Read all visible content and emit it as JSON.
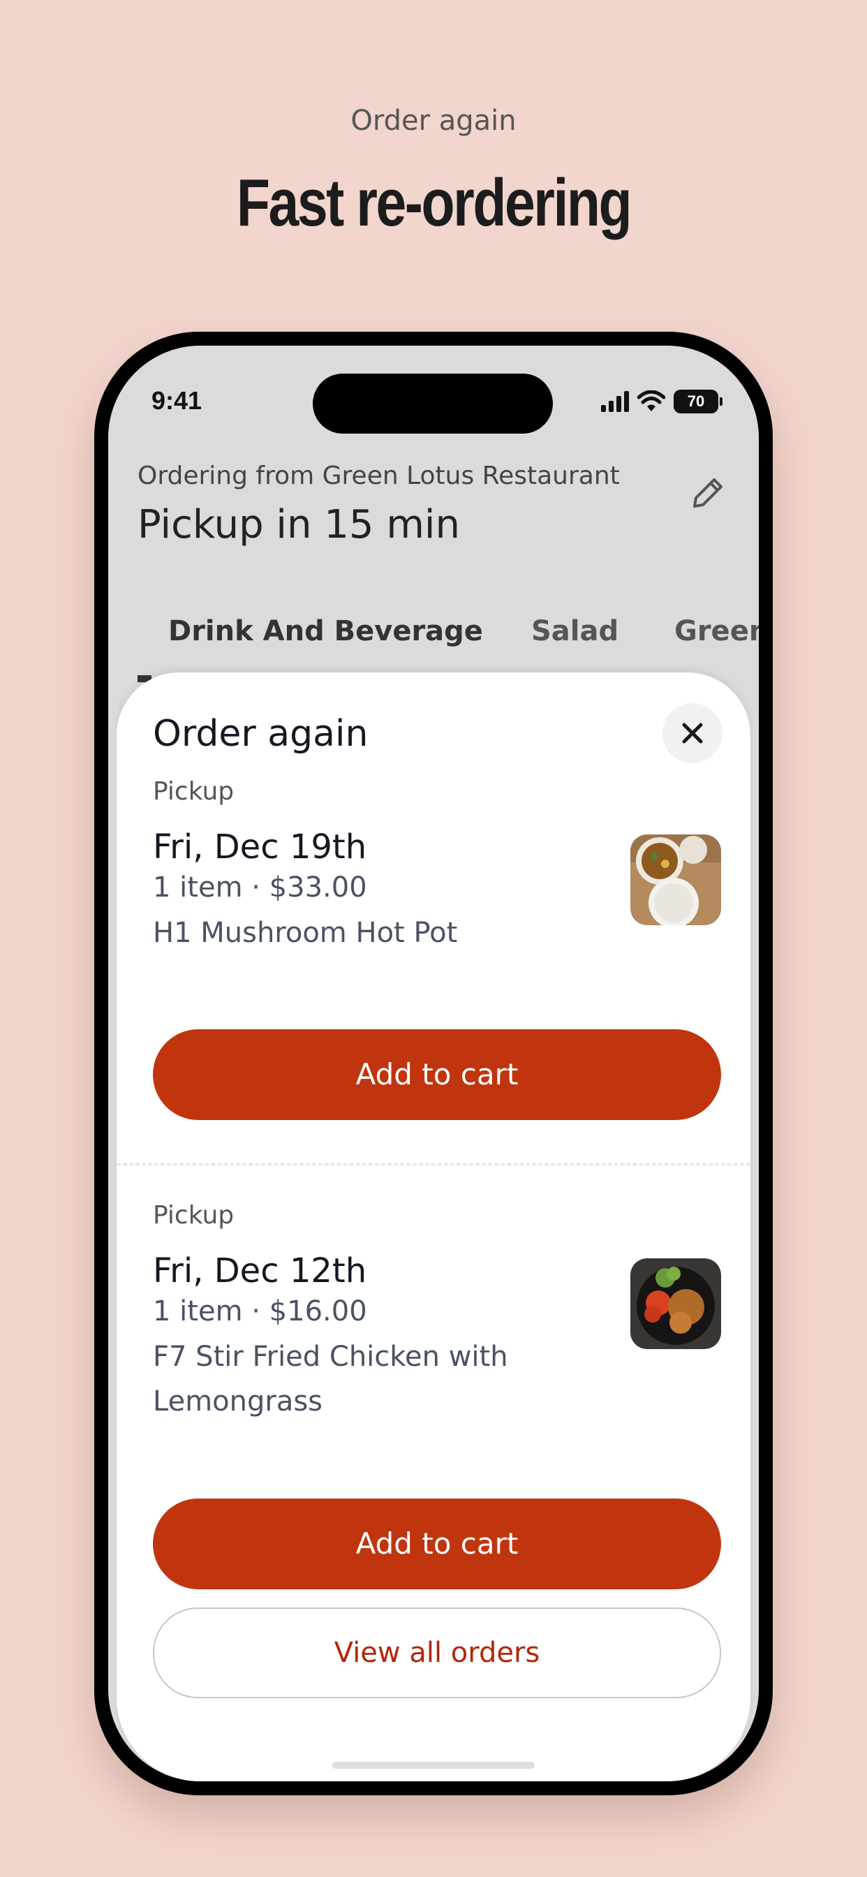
{
  "promo": {
    "eyebrow": "Order again",
    "title": "Fast re-ordering"
  },
  "status_bar": {
    "time": "9:41",
    "battery": "70",
    "icons": [
      "signal-icon",
      "wifi-icon",
      "battery-icon"
    ]
  },
  "header": {
    "ordering_from": "Ordering from Green Lotus Restaurant",
    "pickup_eta": "Pickup in 15 min",
    "edit_icon": "pencil-icon"
  },
  "categories": [
    {
      "label": "Drink And Beverage",
      "active": true
    },
    {
      "label": "Salad",
      "active": false
    },
    {
      "label": "Green I",
      "active": false
    }
  ],
  "sheet": {
    "title": "Order again",
    "close_icon": "close-icon",
    "orders": [
      {
        "type": "Pickup",
        "date": "Fri, Dec 19th",
        "meta": "1 item · $33.00",
        "items": "H1 Mushroom Hot Pot",
        "button": "Add to cart"
      },
      {
        "type": "Pickup",
        "date": "Fri, Dec 12th",
        "meta": "1 item · $16.00",
        "items": "F7 Stir Fried Chicken with Lemongrass",
        "button": "Add to cart"
      }
    ],
    "view_all": "View all orders"
  },
  "colors": {
    "background": "#f2d5cd",
    "accent": "#c0350d",
    "link": "#b3260a"
  }
}
